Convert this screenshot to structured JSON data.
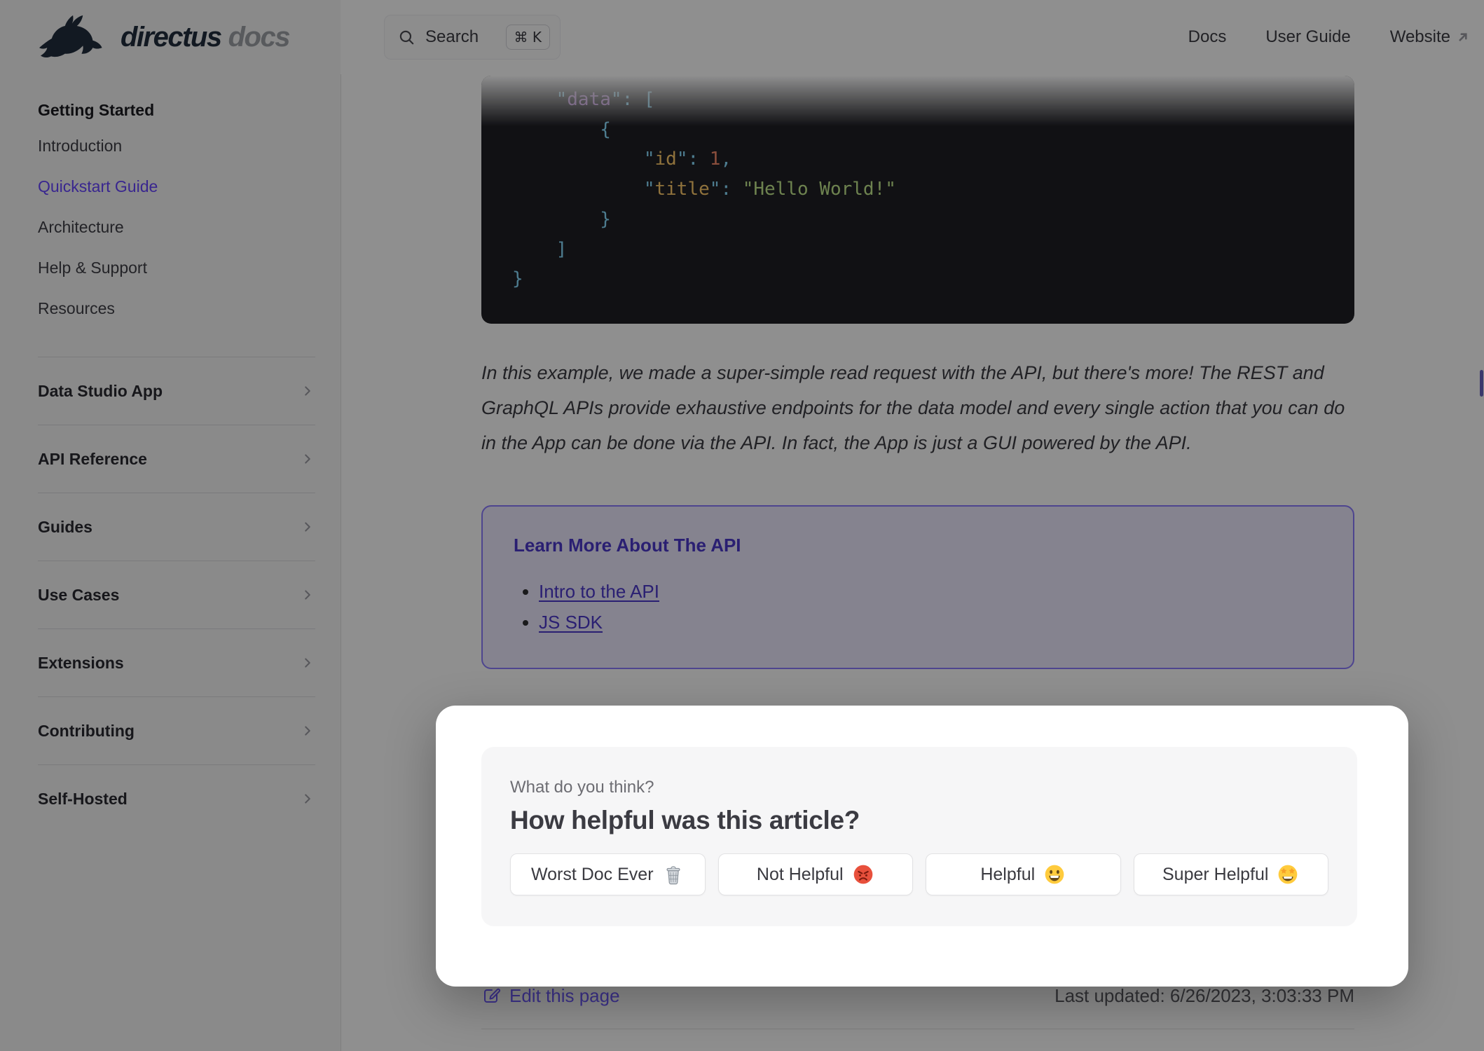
{
  "brand": {
    "wordmark": "directus",
    "wordmark_suffix": "docs"
  },
  "header": {
    "search": {
      "label": "Search",
      "shortcut": "⌘ K"
    },
    "nav": [
      {
        "label": "Docs",
        "external": false
      },
      {
        "label": "User Guide",
        "external": false
      },
      {
        "label": "Website",
        "external": true
      }
    ]
  },
  "sidebar": {
    "groups": [
      {
        "title": "Getting Started",
        "expanded": true,
        "items": [
          {
            "label": "Introduction",
            "active": false
          },
          {
            "label": "Quickstart Guide",
            "active": true
          },
          {
            "label": "Architecture",
            "active": false
          },
          {
            "label": "Help & Support",
            "active": false
          },
          {
            "label": "Resources",
            "active": false
          }
        ]
      },
      {
        "title": "Data Studio App",
        "expanded": false
      },
      {
        "title": "API Reference",
        "expanded": false
      },
      {
        "title": "Guides",
        "expanded": false
      },
      {
        "title": "Use Cases",
        "expanded": false
      },
      {
        "title": "Extensions",
        "expanded": false
      },
      {
        "title": "Contributing",
        "expanded": false
      },
      {
        "title": "Self-Hosted",
        "expanded": false
      }
    ]
  },
  "content": {
    "code_block": {
      "language": "json",
      "lines": [
        [
          {
            "t": "    "
          },
          {
            "t": "\"",
            "c": "p"
          },
          {
            "t": "data",
            "c": "kr"
          },
          {
            "t": "\"",
            "c": "p"
          },
          {
            "t": ": ",
            "c": "p"
          },
          {
            "t": "[",
            "c": "p"
          }
        ],
        [
          {
            "t": "        "
          },
          {
            "t": "{",
            "c": "p"
          }
        ],
        [
          {
            "t": "            "
          },
          {
            "t": "\"",
            "c": "p"
          },
          {
            "t": "id",
            "c": "k"
          },
          {
            "t": "\"",
            "c": "p"
          },
          {
            "t": ": ",
            "c": "p"
          },
          {
            "t": "1",
            "c": "n"
          },
          {
            "t": ",",
            "c": "p"
          }
        ],
        [
          {
            "t": "            "
          },
          {
            "t": "\"",
            "c": "p"
          },
          {
            "t": "title",
            "c": "k"
          },
          {
            "t": "\"",
            "c": "p"
          },
          {
            "t": ": ",
            "c": "p"
          },
          {
            "t": "\"Hello World!\"",
            "c": "s"
          }
        ],
        [
          {
            "t": "        "
          },
          {
            "t": "}",
            "c": "p"
          }
        ],
        [
          {
            "t": "    "
          },
          {
            "t": "]",
            "c": "p"
          }
        ],
        [
          {
            "t": "}",
            "c": "p"
          }
        ]
      ]
    },
    "paragraph": "In this example, we made a super-simple read request with the API, but there's more! The REST and GraphQL APIs provide exhaustive endpoints for the data model and every single action that you can do in the App can be done via the API. In fact, the App is just a GUI powered by the API.",
    "learn_more": {
      "title": "Learn More About The API",
      "links": [
        {
          "label": "Intro to the API"
        },
        {
          "label": "JS SDK"
        }
      ]
    },
    "footer": {
      "edit_label": "Edit this page",
      "last_updated": "Last updated: 6/26/2023, 3:03:33 PM"
    }
  },
  "feedback": {
    "kicker": "What do you think?",
    "question": "How helpful was this article?",
    "options": [
      {
        "label": "Worst Doc Ever",
        "emoji": "wastebasket-emoji"
      },
      {
        "label": "Not Helpful",
        "emoji": "angry-face-emoji"
      },
      {
        "label": "Helpful",
        "emoji": "grinning-face-emoji"
      },
      {
        "label": "Super Helpful",
        "emoji": "star-struck-emoji"
      }
    ]
  },
  "colors": {
    "accent": "#6644ff",
    "sidebar_bg": "#f6f6f7",
    "code_bg": "#1f1f24",
    "overlay": "rgba(0,0,0,0.44)",
    "card_bg": "#f6f6f7",
    "code_tokens": {
      "root_key": "#c792ea",
      "key": "#ffcb6b",
      "string": "#c3e88d",
      "number": "#f78c6c",
      "punctuation": "#89ddff"
    }
  }
}
